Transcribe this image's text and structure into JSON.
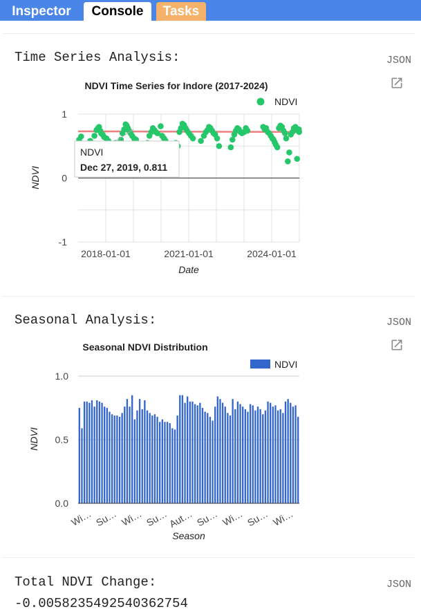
{
  "tabs": {
    "inspector": "Inspector",
    "console": "Console",
    "tasks": "Tasks"
  },
  "sections": {
    "time_series": {
      "title": "Time Series Analysis:",
      "json_label": "JSON"
    },
    "seasonal": {
      "title": "Seasonal Analysis:",
      "json_label": "JSON"
    },
    "total_change": {
      "title": "Total NDVI Change:",
      "json_label": "JSON",
      "value": "-0.005823549254036275​4"
    }
  },
  "chart_data": [
    {
      "type": "scatter",
      "title": "NDVI Time Series for Indore (2017-2024)",
      "xlabel": "Date",
      "ylabel": "NDVI",
      "xlim": [
        "2017-01-01",
        "2024-12-31"
      ],
      "ylim": [
        -1,
        1
      ],
      "y_ticks": [
        "1",
        "0",
        "-1"
      ],
      "x_ticks": [
        "2018-01-01",
        "2021-01-01",
        "2024-01-01"
      ],
      "legend": {
        "label": "NDVI",
        "position": "top-right"
      },
      "trendline": {
        "color": "#ef7e7e",
        "start": 0.73,
        "end": 0.72
      },
      "point_color": "#26c66a",
      "tooltip": {
        "series": "NDVI",
        "text": "Dec 27, 2019, 0.811"
      },
      "series": [
        {
          "name": "NDVI",
          "points": [
            [
              "2017-01-15",
              0.6
            ],
            [
              "2017-02-10",
              0.65
            ],
            [
              "2017-06-10",
              0.58
            ],
            [
              "2017-08-05",
              0.66
            ],
            [
              "2017-09-01",
              0.75
            ],
            [
              "2017-09-20",
              0.78
            ],
            [
              "2017-10-05",
              0.8
            ],
            [
              "2017-10-20",
              0.74
            ],
            [
              "2017-11-01",
              0.7
            ],
            [
              "2017-11-20",
              0.68
            ],
            [
              "2017-12-10",
              0.64
            ],
            [
              "2018-01-10",
              0.62
            ],
            [
              "2018-02-05",
              0.58
            ],
            [
              "2018-05-10",
              0.55
            ],
            [
              "2018-07-20",
              0.6
            ],
            [
              "2018-08-10",
              0.7
            ],
            [
              "2018-09-01",
              0.76
            ],
            [
              "2018-09-20",
              0.84
            ],
            [
              "2018-10-05",
              0.82
            ],
            [
              "2018-10-20",
              0.78
            ],
            [
              "2018-11-05",
              0.74
            ],
            [
              "2018-11-25",
              0.7
            ],
            [
              "2018-12-15",
              0.66
            ],
            [
              "2019-01-10",
              0.62
            ],
            [
              "2019-02-05",
              0.6
            ],
            [
              "2019-07-05",
              0.55
            ],
            [
              "2019-08-01",
              0.66
            ],
            [
              "2019-08-25",
              0.72
            ],
            [
              "2019-09-15",
              0.78
            ],
            [
              "2019-10-05",
              0.75
            ],
            [
              "2019-10-25",
              0.72
            ],
            [
              "2019-11-15",
              0.7
            ],
            [
              "2019-12-27",
              0.81
            ],
            [
              "2020-01-15",
              0.66
            ],
            [
              "2020-02-10",
              0.62
            ],
            [
              "2020-03-01",
              0.58
            ],
            [
              "2020-07-15",
              0.55
            ],
            [
              "2020-08-10",
              0.5
            ],
            [
              "2020-08-30",
              0.72
            ],
            [
              "2020-09-20",
              0.78
            ],
            [
              "2020-10-10",
              0.85
            ],
            [
              "2020-10-30",
              0.83
            ],
            [
              "2020-11-20",
              0.78
            ],
            [
              "2020-12-10",
              0.74
            ],
            [
              "2021-01-05",
              0.7
            ],
            [
              "2021-01-30",
              0.66
            ],
            [
              "2021-02-25",
              0.62
            ],
            [
              "2021-06-10",
              0.58
            ],
            [
              "2021-07-20",
              0.66
            ],
            [
              "2021-08-15",
              0.72
            ],
            [
              "2021-09-05",
              0.75
            ],
            [
              "2021-09-25",
              0.8
            ],
            [
              "2021-10-15",
              0.78
            ],
            [
              "2021-11-05",
              0.74
            ],
            [
              "2021-11-25",
              0.7
            ],
            [
              "2021-12-15",
              0.68
            ],
            [
              "2022-01-10",
              0.62
            ],
            [
              "2022-02-05",
              0.5
            ],
            [
              "2022-07-10",
              0.48
            ],
            [
              "2022-08-01",
              0.6
            ],
            [
              "2022-08-25",
              0.68
            ],
            [
              "2022-09-15",
              0.74
            ],
            [
              "2022-10-05",
              0.78
            ],
            [
              "2022-10-25",
              0.76
            ],
            [
              "2022-11-15",
              0.72
            ],
            [
              "2022-12-05",
              0.7
            ],
            [
              "2023-01-01",
              0.72
            ],
            [
              "2023-01-25",
              0.78
            ],
            [
              "2023-02-15",
              0.74
            ],
            [
              "2023-09-10",
              0.8
            ],
            [
              "2023-10-01",
              0.76
            ],
            [
              "2023-10-20",
              0.78
            ],
            [
              "2023-11-10",
              0.72
            ],
            [
              "2023-11-30",
              0.7
            ],
            [
              "2023-12-20",
              0.66
            ],
            [
              "2024-01-10",
              0.62
            ],
            [
              "2024-01-25",
              0.6
            ],
            [
              "2024-02-10",
              0.56
            ],
            [
              "2024-02-25",
              0.52
            ],
            [
              "2024-03-15",
              0.48
            ],
            [
              "2024-04-05",
              0.78
            ],
            [
              "2024-04-25",
              0.82
            ],
            [
              "2024-05-15",
              0.8
            ],
            [
              "2024-06-05",
              0.74
            ],
            [
              "2024-06-25",
              0.7
            ],
            [
              "2024-07-10",
              0.62
            ],
            [
              "2024-08-01",
              0.26
            ],
            [
              "2024-08-20",
              0.4
            ],
            [
              "2024-09-10",
              0.68
            ],
            [
              "2024-10-01",
              0.72
            ],
            [
              "2024-10-20",
              0.78
            ],
            [
              "2024-11-10",
              0.8
            ],
            [
              "2024-12-01",
              0.3
            ],
            [
              "2024-12-15",
              0.74
            ],
            [
              "2024-12-25",
              0.76
            ],
            [
              "2024-12-28",
              0.72
            ]
          ]
        }
      ]
    },
    {
      "type": "bar",
      "title": "Seasonal NDVI Distribution",
      "xlabel": "Season",
      "ylabel": "NDVI",
      "ylim": [
        0,
        1
      ],
      "y_ticks": [
        "1.0",
        "0.5",
        "0.0"
      ],
      "x_ticks": [
        "Wi…",
        "Su…",
        "Wi…",
        "Su…",
        "Aut…",
        "Su…",
        "Wi…",
        "Su…",
        "Wi…"
      ],
      "legend": {
        "label": "NDVI",
        "position": "top-right"
      },
      "bar_color": "#3366cc",
      "series": [
        {
          "name": "NDVI",
          "values": [
            0.75,
            0.59,
            0.8,
            0.8,
            0.79,
            0.81,
            0.76,
            0.81,
            0.8,
            0.79,
            0.76,
            0.75,
            0.72,
            0.7,
            0.69,
            0.69,
            0.68,
            0.71,
            0.76,
            0.82,
            0.76,
            0.85,
            0.66,
            0.73,
            0.82,
            0.74,
            0.81,
            0.73,
            0.71,
            0.69,
            0.7,
            0.68,
            0.64,
            0.66,
            0.64,
            0.64,
            0.63,
            0.59,
            0.58,
            0.69,
            0.85,
            0.85,
            0.79,
            0.84,
            0.8,
            0.8,
            0.78,
            0.77,
            0.79,
            0.75,
            0.72,
            0.71,
            0.68,
            0.65,
            0.76,
            0.84,
            0.82,
            0.79,
            0.76,
            0.71,
            0.69,
            0.82,
            0.74,
            0.8,
            0.78,
            0.76,
            0.74,
            0.72,
            0.78,
            0.77,
            0.73,
            0.76,
            0.74,
            0.7,
            0.73,
            0.8,
            0.79,
            0.76,
            0.77,
            0.73,
            0.74,
            0.71,
            0.8,
            0.82,
            0.79,
            0.76,
            0.77,
            0.68
          ]
        }
      ]
    }
  ]
}
